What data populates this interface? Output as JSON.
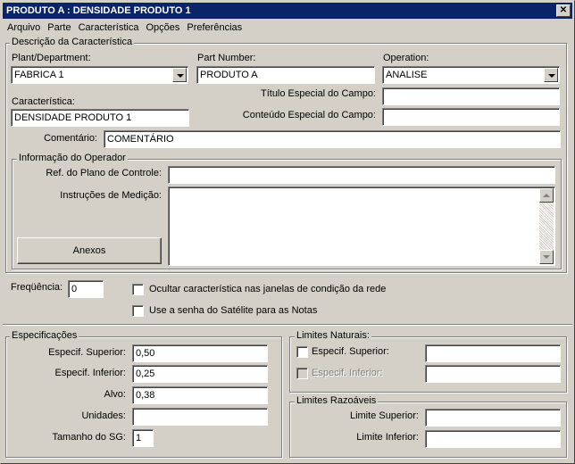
{
  "window": {
    "title": "PRODUTO A : DENSIDADE PRODUTO 1",
    "close_glyph": "✕"
  },
  "menu": [
    "Arquivo",
    "Parte",
    "Característica",
    "Opções",
    "Preferências"
  ],
  "descricao": {
    "legend": "Descrição da Característica",
    "plant_label": "Plant/Department:",
    "plant_value": "FABRICA 1",
    "part_label": "Part Number:",
    "part_value": "PRODUTO A",
    "operation_label": "Operation:",
    "operation_value": "ANALISE",
    "titulo_label": "Título Especial do Campo:",
    "titulo_value": "",
    "caracteristica_label": "Característica:",
    "caracteristica_value": "DENSIDADE PRODUTO 1",
    "conteudo_label": "Conteúdo Especial do Campo:",
    "conteudo_value": "",
    "comentario_label": "Comentário:",
    "comentario_value": "COMENTÁRIO"
  },
  "operador": {
    "legend": "Informação do Operador",
    "ref_label": "Ref. do Plano de Controle:",
    "ref_value": "",
    "instrucoes_label": "Instruções de Medição:",
    "instrucoes_value": "",
    "anexos_label": "Anexos"
  },
  "frequencia_label": "Freqüência:",
  "frequencia_value": "0",
  "ocultar_label": "Ocultar característica nas janelas de condição da rede",
  "ocultar_checked": false,
  "senha_label": "Use a senha do Satélite para as Notas",
  "senha_checked": false,
  "especificacoes": {
    "legend": "Especificações",
    "superior_label": "Especif. Superior:",
    "superior_value": "0,50",
    "inferior_label": "Especif. Inferior:",
    "inferior_value": "0,25",
    "alvo_label": "Alvo:",
    "alvo_value": "0,38",
    "unidades_label": "Unidades:",
    "unidades_value": "",
    "sg_label": "Tamanho do SG:",
    "sg_value": "1"
  },
  "limites_naturais": {
    "legend": "Limites Naturais:",
    "superior_label": "Especif. Superior:",
    "superior_value": "",
    "inferior_label": "Especif. Inferior:",
    "inferior_value": ""
  },
  "limites_razoaveis": {
    "legend": "Limites Razoáveis",
    "superior_label": "Limite Superior:",
    "superior_value": "",
    "inferior_label": "Limite Inferior:",
    "inferior_value": ""
  },
  "colors": {
    "titlebar": "#0a246a",
    "face": "#d4d0c8"
  }
}
